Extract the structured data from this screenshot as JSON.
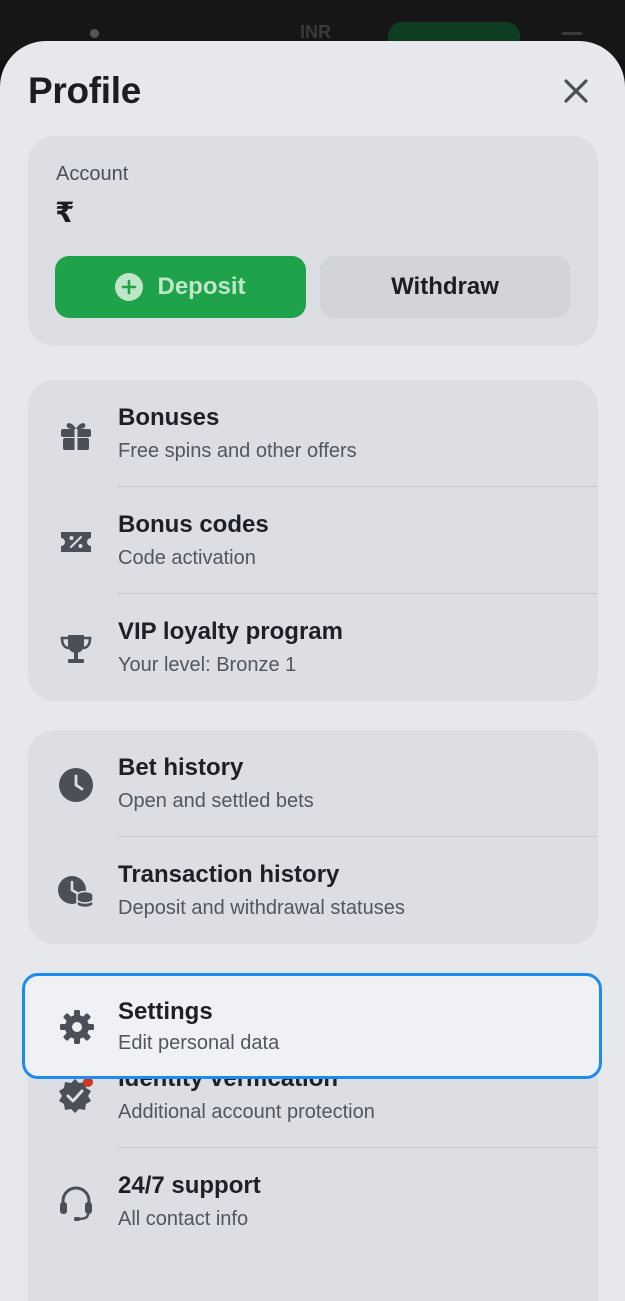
{
  "header": {
    "currency_code": "INR"
  },
  "profile": {
    "title": "Profile"
  },
  "account": {
    "label": "Account",
    "currency_symbol": "₹",
    "deposit_label": "Deposit",
    "withdraw_label": "Withdraw"
  },
  "group1": [
    {
      "title": "Bonuses",
      "subtitle": "Free spins and other offers",
      "icon": "gift-icon"
    },
    {
      "title": "Bonus codes",
      "subtitle": "Code activation",
      "icon": "coupon-icon"
    },
    {
      "title": "VIP loyalty program",
      "subtitle": "Your level: Bronze 1",
      "icon": "trophy-icon"
    }
  ],
  "group2": [
    {
      "title": "Bet history",
      "subtitle": "Open and settled bets",
      "icon": "clock-icon"
    },
    {
      "title": "Transaction history",
      "subtitle": "Deposit and withdrawal statuses",
      "icon": "transaction-clock-icon"
    }
  ],
  "settings": {
    "title": "Settings",
    "subtitle": "Edit personal data",
    "icon": "gear-icon"
  },
  "group3": [
    {
      "title": "Identity verification",
      "subtitle": "Additional account protection",
      "icon": "verified-badge-icon"
    },
    {
      "title": "24/7 support",
      "subtitle": "All contact info",
      "icon": "headset-icon"
    }
  ],
  "colors": {
    "accent_green": "#1ea24a",
    "focus_blue": "#1d8cf0",
    "notification_red": "#d6361f"
  }
}
